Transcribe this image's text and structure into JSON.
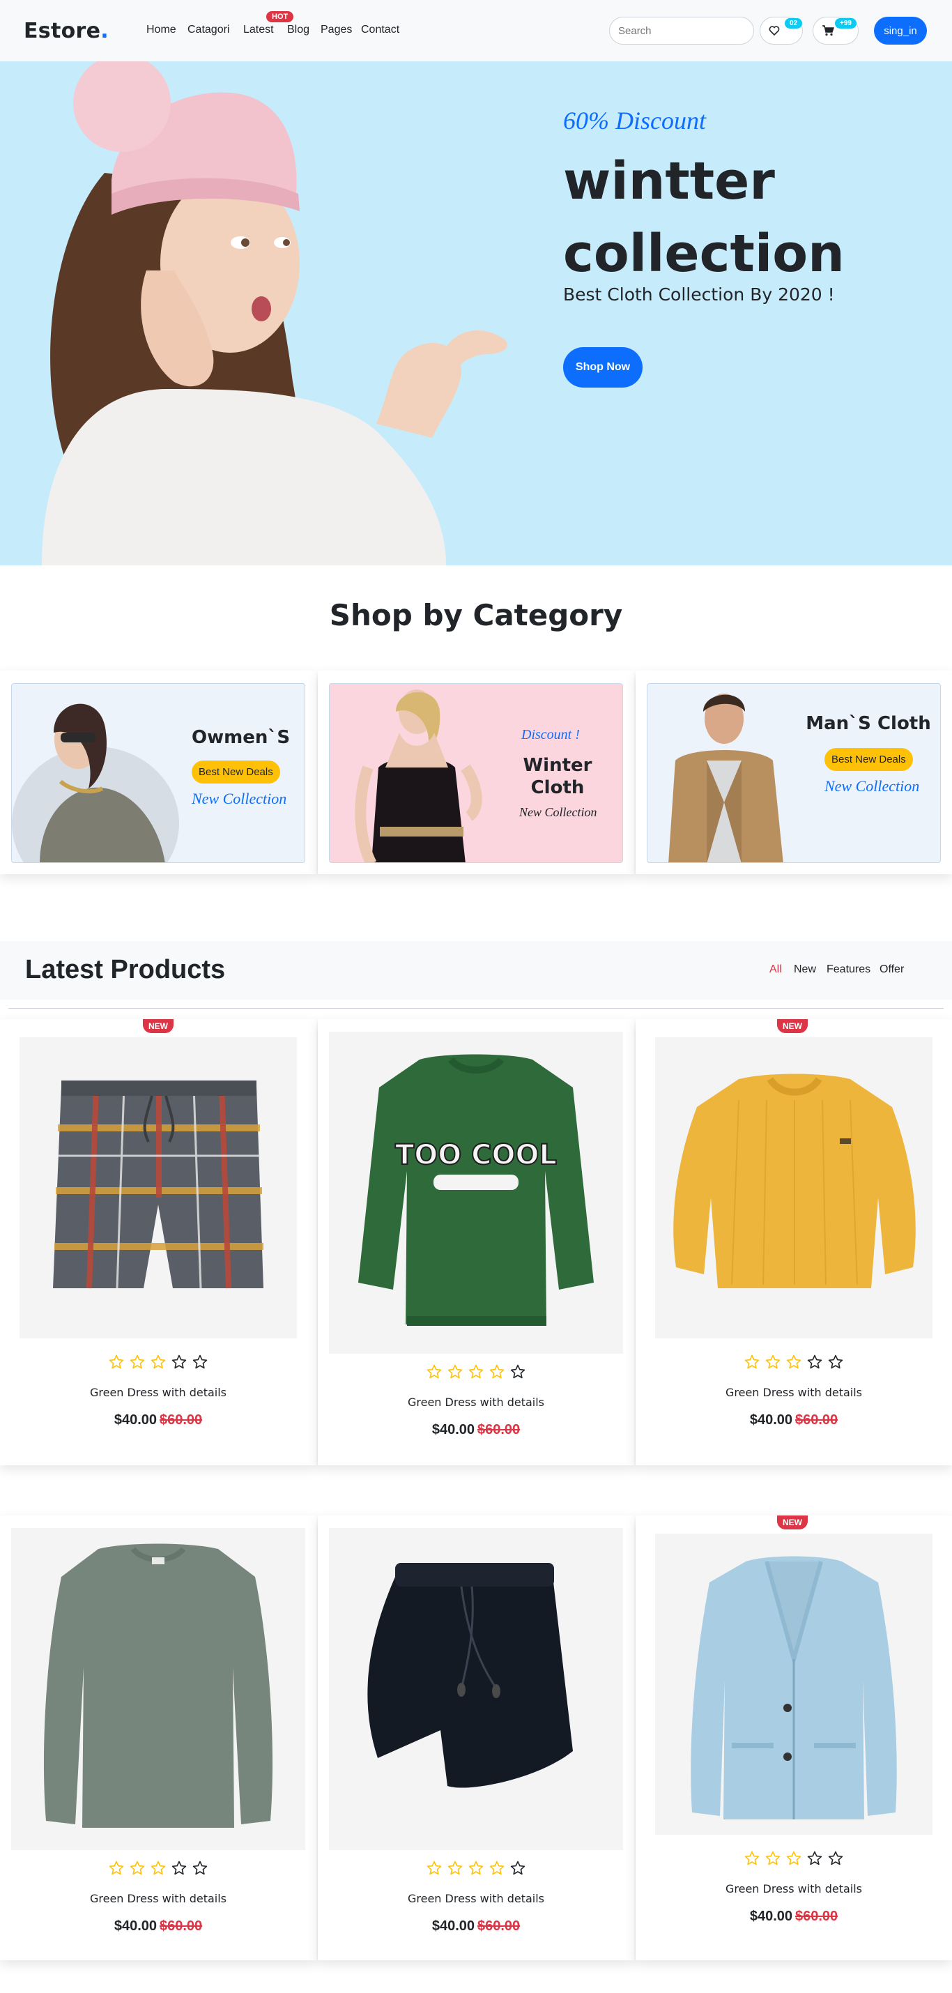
{
  "brand": {
    "name": "Estore",
    "dot": "."
  },
  "nav": {
    "links": [
      "Home",
      "Catagori",
      "Latest",
      "Blog",
      "Pages",
      "Contact"
    ],
    "hot_badge": "HOT"
  },
  "search": {
    "placeholder": "Search"
  },
  "wishlist": {
    "count": "02",
    "icon": "heart-icon"
  },
  "cart": {
    "count": "+99",
    "icon": "cart-icon"
  },
  "signin": {
    "label": "sing_in"
  },
  "hero": {
    "subtitle": "60% Discount",
    "title": "wintter collection",
    "description": "Best Cloth Collection By 2020 !",
    "button": "Shop Now",
    "bg_color": "#c6ebfb"
  },
  "category_section": {
    "title": "Shop by Category",
    "cards": [
      {
        "title": "Owmen`S",
        "badge": "Best New Deals",
        "tagline": "New Collection"
      },
      {
        "discount": "Discount !",
        "title_line1": "Winter",
        "title_line2": "Cloth",
        "tagline": "New Collection"
      },
      {
        "title": "Man`S Cloth",
        "badge": "Best New Deals",
        "tagline": "New Collection"
      }
    ]
  },
  "latest": {
    "title": "Latest Products",
    "filters": [
      "All",
      "New",
      "Features",
      "Offer"
    ],
    "active_filter": "All"
  },
  "products": [
    {
      "name": "Green Dress with details",
      "price": "$40.00",
      "old_price": "$60.00",
      "rating": 3,
      "badge": "NEW"
    },
    {
      "name": "Green Dress with details",
      "price": "$40.00",
      "old_price": "$60.00",
      "rating": 4,
      "badge": ""
    },
    {
      "name": "Green Dress with details",
      "price": "$40.00",
      "old_price": "$60.00",
      "rating": 3,
      "badge": "NEW"
    },
    {
      "name": "Green Dress with details",
      "price": "$40.00",
      "old_price": "$60.00",
      "rating": 3,
      "badge": ""
    },
    {
      "name": "Green Dress with details",
      "price": "$40.00",
      "old_price": "$60.00",
      "rating": 4,
      "badge": ""
    },
    {
      "name": "Green Dress with details",
      "price": "$40.00",
      "old_price": "$60.00",
      "rating": 3,
      "badge": "NEW"
    }
  ],
  "colors": {
    "primary": "#0d6efd",
    "danger": "#dc3545",
    "warning": "#ffc107",
    "info": "#0dcaf0",
    "star": "#ffc107"
  }
}
